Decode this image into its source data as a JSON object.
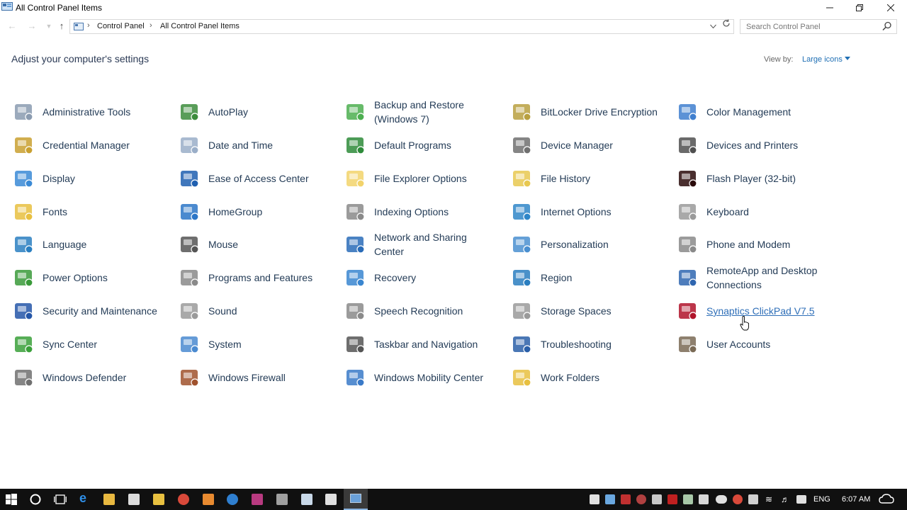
{
  "window": {
    "title": "All Control Panel Items"
  },
  "address": {
    "crumbs": [
      "Control Panel",
      "All Control Panel Items"
    ],
    "search_placeholder": "Search Control Panel"
  },
  "content": {
    "heading": "Adjust your computer's settings",
    "view_by_label": "View by:",
    "view_by_value": "Large icons"
  },
  "items": [
    {
      "label": "Administrative Tools",
      "icon": "admin-tools-icon",
      "color": "#8a9bb0"
    },
    {
      "label": "AutoPlay",
      "icon": "autoplay-icon",
      "color": "#3c8c3c"
    },
    {
      "label": "Backup and Restore (Windows 7)",
      "icon": "backup-icon",
      "color": "#4caf50"
    },
    {
      "label": "BitLocker Drive Encryption",
      "icon": "bitlocker-icon",
      "color": "#b8a040"
    },
    {
      "label": "Color Management",
      "icon": "color-management-icon",
      "color": "#3f7fcf"
    },
    {
      "label": "Credential Manager",
      "icon": "credential-icon",
      "color": "#c9a030"
    },
    {
      "label": "Date and Time",
      "icon": "clock-icon",
      "color": "#9aaec8"
    },
    {
      "label": "Default Programs",
      "icon": "default-programs-icon",
      "color": "#2e8b3a"
    },
    {
      "label": "Device Manager",
      "icon": "device-manager-icon",
      "color": "#707070"
    },
    {
      "label": "Devices and Printers",
      "icon": "printer-icon",
      "color": "#505050"
    },
    {
      "label": "Display",
      "icon": "display-icon",
      "color": "#3a8ad6"
    },
    {
      "label": "Ease of Access Center",
      "icon": "ease-of-access-icon",
      "color": "#1f5fb0"
    },
    {
      "label": "File Explorer Options",
      "icon": "folder-options-icon",
      "color": "#f2d36b"
    },
    {
      "label": "File History",
      "icon": "file-history-icon",
      "color": "#e8c850"
    },
    {
      "label": "Flash Player (32-bit)",
      "icon": "flash-icon",
      "color": "#2a0a0a"
    },
    {
      "label": "Fonts",
      "icon": "fonts-icon",
      "color": "#e8c040"
    },
    {
      "label": "HomeGroup",
      "icon": "homegroup-icon",
      "color": "#2c76c7"
    },
    {
      "label": "Indexing Options",
      "icon": "indexing-icon",
      "color": "#8a8a8a"
    },
    {
      "label": "Internet Options",
      "icon": "internet-options-icon",
      "color": "#2f86c8"
    },
    {
      "label": "Keyboard",
      "icon": "keyboard-icon",
      "color": "#9a9a9a"
    },
    {
      "label": "Language",
      "icon": "language-icon",
      "color": "#2a7fc1"
    },
    {
      "label": "Mouse",
      "icon": "mouse-icon",
      "color": "#555555"
    },
    {
      "label": "Network and Sharing Center",
      "icon": "network-icon",
      "color": "#2a6cb8"
    },
    {
      "label": "Personalization",
      "icon": "personalization-icon",
      "color": "#4a8fd0"
    },
    {
      "label": "Phone and Modem",
      "icon": "phone-icon",
      "color": "#8a8a8a"
    },
    {
      "label": "Power Options",
      "icon": "power-options-icon",
      "color": "#3a9a3a"
    },
    {
      "label": "Programs and Features",
      "icon": "programs-icon",
      "color": "#8a8a8a"
    },
    {
      "label": "Recovery",
      "icon": "recovery-icon",
      "color": "#3a86d0"
    },
    {
      "label": "Region",
      "icon": "region-icon",
      "color": "#2a7ec0"
    },
    {
      "label": "RemoteApp and Desktop Connections",
      "icon": "remoteapp-icon",
      "color": "#2f66b0"
    },
    {
      "label": "Security and Maintenance",
      "icon": "flag-icon",
      "color": "#2456a8"
    },
    {
      "label": "Sound",
      "icon": "sound-icon",
      "color": "#9a9a9a"
    },
    {
      "label": "Speech Recognition",
      "icon": "microphone-icon",
      "color": "#8a8a8a"
    },
    {
      "label": "Storage Spaces",
      "icon": "storage-icon",
      "color": "#9a9a9a"
    },
    {
      "label": "Synaptics ClickPad V7.5",
      "icon": "synaptics-icon",
      "color": "#b0132a"
    },
    {
      "label": "Sync Center",
      "icon": "sync-icon",
      "color": "#3aa03a"
    },
    {
      "label": "System",
      "icon": "system-icon",
      "color": "#4a8ad0"
    },
    {
      "label": "Taskbar and Navigation",
      "icon": "taskbar-icon",
      "color": "#555555"
    },
    {
      "label": "Troubleshooting",
      "icon": "troubleshooting-icon",
      "color": "#2a5fa8"
    },
    {
      "label": "User Accounts",
      "icon": "users-icon",
      "color": "#7a6a55"
    },
    {
      "label": "Windows Defender",
      "icon": "defender-icon",
      "color": "#707070"
    },
    {
      "label": "Windows Firewall",
      "icon": "firewall-icon",
      "color": "#a0522d"
    },
    {
      "label": "Windows Mobility Center",
      "icon": "mobility-icon",
      "color": "#3a7ac8"
    },
    {
      "label": "Work Folders",
      "icon": "work-folders-icon",
      "color": "#e8c040"
    }
  ],
  "taskbar": {
    "language": "ENG",
    "time": "6:07 AM"
  }
}
